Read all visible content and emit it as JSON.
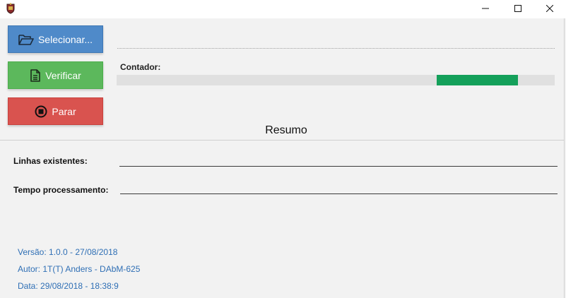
{
  "window": {
    "icon": "coat-of-arms-icon",
    "controls": {
      "minimize": "minimize-icon",
      "maximize": "maximize-icon",
      "close": "close-icon"
    }
  },
  "buttons": {
    "select": {
      "label": "Selecionar...",
      "icon": "folder-open-icon",
      "color": "#4f8ac9"
    },
    "verify": {
      "label": "Verificar",
      "icon": "document-icon",
      "color": "#5cb85c"
    },
    "stop": {
      "label": "Parar",
      "icon": "stop-icon",
      "color": "#d9534f"
    }
  },
  "counter": {
    "label": "Contador:",
    "progress_fill_color": "#14a05a"
  },
  "summary": {
    "title": "Resumo",
    "lines_label": "Linhas existentes:",
    "lines_value": "",
    "time_label": "Tempo processamento:",
    "time_value": ""
  },
  "footer": {
    "version": "Versão: 1.0.0 - 27/08/2018",
    "author": "Autor: 1T(T) Anders - DAbM-625",
    "date": "Data: 29/08/2018 - 18:38:9"
  }
}
